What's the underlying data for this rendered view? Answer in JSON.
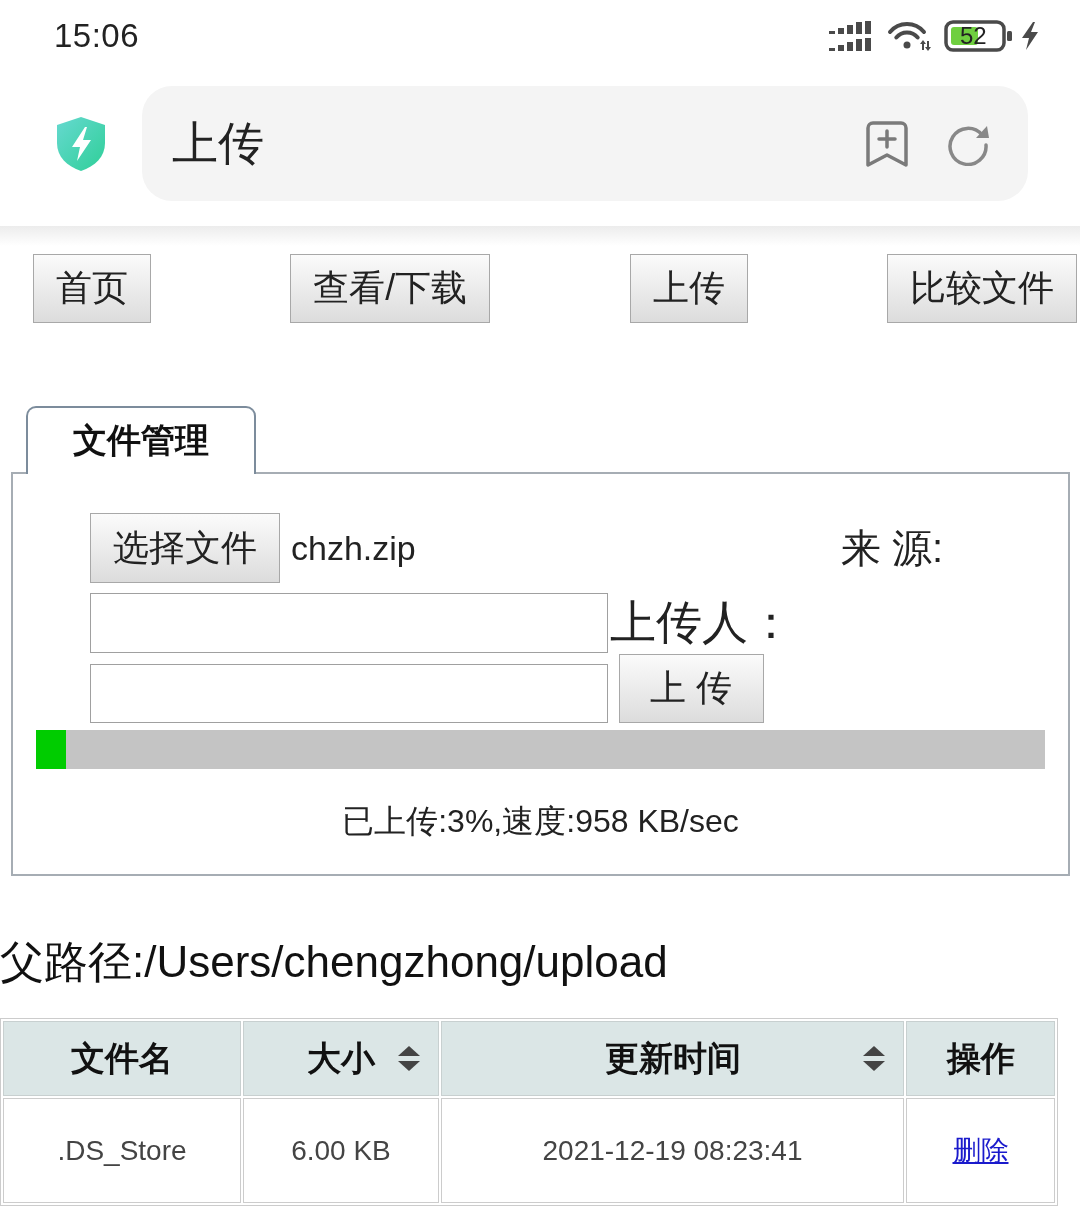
{
  "status_bar": {
    "time": "15:06",
    "battery": "52"
  },
  "address_bar": {
    "title": "上传"
  },
  "nav_buttons": [
    "首页",
    "查看/下载",
    "上传",
    "比较文件"
  ],
  "upload_panel": {
    "tab": "文件管理",
    "choose_file_button": "选择文件",
    "file_name": "chzh.zip",
    "source_label": "来 源:",
    "uploader_label": "上传人：",
    "upload_button": "上 传",
    "progress": {
      "level": 0.03
    },
    "progress_text": "已上传:3%,速度:958 KB/sec"
  },
  "parent_path": "父路径:/Users/chengzhong/upload",
  "table": {
    "columns": [
      {
        "label": "文件名",
        "sortable": false
      },
      {
        "label": "大小",
        "sortable": true
      },
      {
        "label": "更新时间",
        "sortable": true
      },
      {
        "label": "操作",
        "sortable": false
      }
    ],
    "rows": [
      {
        "cells": [
          ".DS_Store",
          "6.00 KB",
          "2021-12-19 08:23:41"
        ],
        "action": "删除"
      }
    ]
  }
}
